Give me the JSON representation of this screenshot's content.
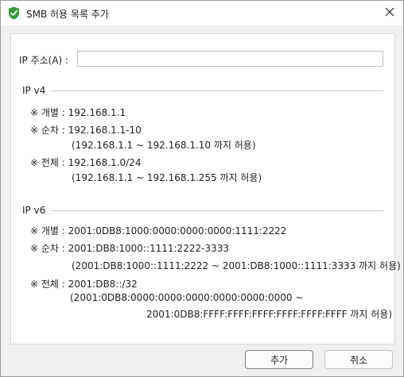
{
  "window": {
    "title": "SMB 허용 목록 추가",
    "icon": "green-shield-check-icon",
    "close_icon": "close-icon"
  },
  "ip_field": {
    "label": "IP 주소(A) :",
    "value": "",
    "placeholder": ""
  },
  "ipv4": {
    "title": "IP v4",
    "lines": [
      "※ 개별 : 192.168.1.1",
      "※ 순차 : 192.168.1.1-10",
      "(192.168.1.1 ~ 192.168.1.10 까지 허용)",
      "※ 전체 : 192.168.1.0/24",
      "(192.168.1.1 ~ 192.168.1.255 까지 허용)"
    ]
  },
  "ipv6": {
    "title": "IP v6",
    "lines": [
      "※ 개별 : 2001:0DB8:1000:0000:0000:0000:1111:2222",
      "※ 순차 : 2001:DB8:1000::1111:2222-3333",
      "(2001:DB8:1000::1111:2222 ~ 2001:DB8:1000::1111:3333 까지 허용)",
      "※ 전체 : 2001:DB8::/32",
      "(2001:0DB8:0000:0000:0000:0000:0000:0000 ~",
      "2001:0DB8:FFFF:FFFF:FFFF:FFFF:FFFF:FFFF 까지 허용)"
    ]
  },
  "buttons": {
    "add": "추가",
    "cancel": "취소"
  },
  "colors": {
    "icon_green": "#2e9e3a",
    "panel_border": "#d6d6d6"
  }
}
